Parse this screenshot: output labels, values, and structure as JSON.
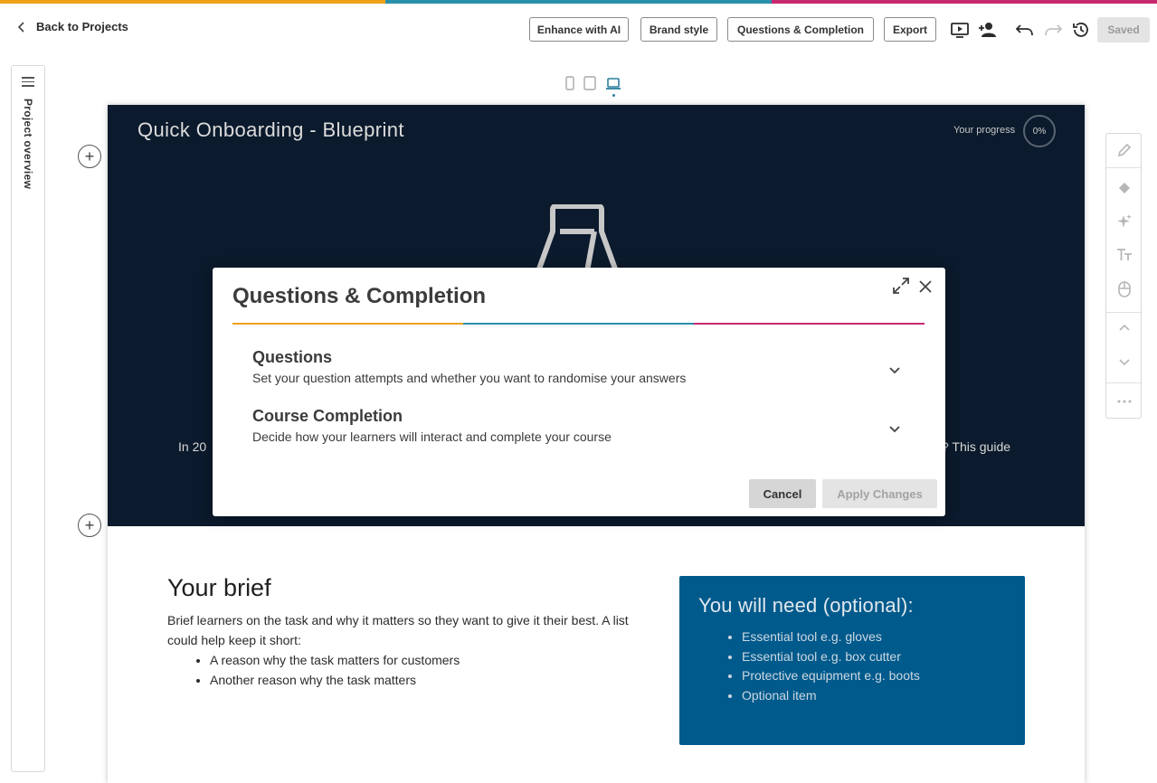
{
  "colors": {
    "orange": "#f0a11c",
    "teal": "#2a8fa8",
    "magenta": "#c8286f",
    "hero_bg": "#0b1a2c",
    "need_bg": "#005a8c"
  },
  "header": {
    "back_label": "Back to Projects",
    "buttons": {
      "enhance": "Enhance with AI",
      "brand": "Brand style",
      "questions": "Questions & Completion",
      "export": "Export"
    },
    "icons": [
      "present-icon",
      "add-user-icon",
      "undo-icon",
      "redo-icon",
      "history-icon"
    ],
    "saved_label": "Saved"
  },
  "sidebar": {
    "label": "Project overview"
  },
  "devices": {
    "items": [
      "mobile-icon",
      "tablet-icon",
      "desktop-icon"
    ],
    "active": "desktop"
  },
  "hero": {
    "title": "Quick Onboarding - Blueprint",
    "progress_label": "Your progress",
    "progress_value": "0%",
    "text_left": "In 20",
    "text_right": "? This guide"
  },
  "brief": {
    "title": "Your brief",
    "text": "Brief learners on the task and why it matters so they want to give it their best. A list could help keep it short:",
    "items": [
      "A reason why the task matters for customers",
      "Another reason why the task matters"
    ]
  },
  "need": {
    "title": "You will need (optional):",
    "items": [
      "Essential tool e.g. gloves",
      "Essential tool e.g. box cutter",
      "Protective equipment e.g. boots",
      "Optional item"
    ]
  },
  "modal": {
    "title": "Questions & Completion",
    "sections": [
      {
        "title": "Questions",
        "description": "Set your question attempts and whether you want to randomise your answers"
      },
      {
        "title": "Course Completion",
        "description": "Decide how your learners will interact and complete your course"
      }
    ],
    "cancel_label": "Cancel",
    "apply_label": "Apply Changes"
  }
}
